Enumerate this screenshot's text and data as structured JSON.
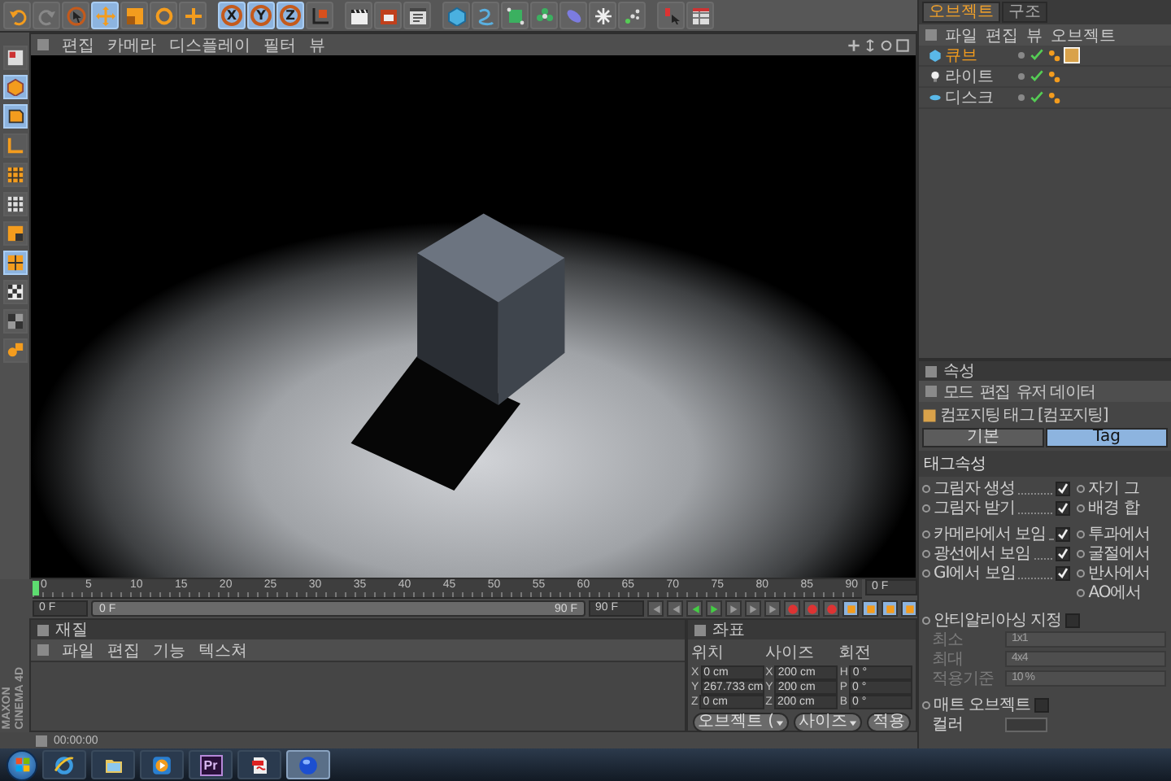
{
  "toolbar": [
    {
      "selected": false
    },
    {
      "selected": false
    },
    {
      "selected": false
    },
    {
      "selected": true
    },
    {
      "selected": false
    },
    {
      "selected": false
    },
    {
      "selected": false
    },
    {
      "label": "X",
      "selected": true
    },
    {
      "label": "Y",
      "selected": true
    },
    {
      "label": "Z",
      "selected": true
    },
    {
      "selected": false
    },
    {
      "selected": false
    },
    {
      "selected": false
    },
    {
      "selected": false
    },
    {
      "selected": false
    },
    {
      "selected": false
    },
    {
      "selected": false
    },
    {
      "selected": false
    },
    {
      "selected": false
    },
    {
      "selected": false
    },
    {
      "selected": false
    },
    {
      "selected": false
    },
    {
      "selected": false
    }
  ],
  "left_toolbar": [
    {
      "selected": false
    },
    {
      "selected": true
    },
    {
      "selected": true
    },
    {
      "selected": false
    },
    {
      "selected": false
    },
    {
      "selected": false
    },
    {
      "selected": false
    },
    {
      "selected": true
    },
    {
      "selected": false
    },
    {
      "selected": false
    },
    {
      "selected": false
    }
  ],
  "viewport": {
    "menu": [
      "편집",
      "카메라",
      "디스플레이",
      "필터",
      "뷰"
    ]
  },
  "timeline": {
    "ruler": [
      "0",
      "5",
      "10",
      "15",
      "20",
      "25",
      "30",
      "35",
      "40",
      "45",
      "50",
      "55",
      "60",
      "65",
      "70",
      "75",
      "80",
      "85",
      "90"
    ],
    "playhead": {
      "level": 0
    },
    "current_frame": "0 F",
    "start": "0 F",
    "slider_start": "0 F",
    "slider_end": "90 F",
    "end": "90 F"
  },
  "logo": {
    "line_1": "MAXON",
    "line_2": "CINEMA 4D"
  },
  "material": {
    "title": "재질",
    "menu": [
      "파일",
      "편집",
      "기능",
      "텍스쳐"
    ]
  },
  "coordinates": {
    "title": "좌표",
    "headers": [
      "위치",
      "사이즈",
      "회전"
    ],
    "rows": [
      [
        {
          "axis": "X",
          "value": "0 cm"
        },
        {
          "axis": "X",
          "value": "200 cm"
        },
        {
          "axis": "H",
          "value": "0 °"
        }
      ],
      [
        {
          "axis": "Y",
          "value": "267.733 cm"
        },
        {
          "axis": "Y",
          "value": "200 cm"
        },
        {
          "axis": "P",
          "value": "0 °"
        }
      ],
      [
        {
          "axis": "Z",
          "value": "0 cm"
        },
        {
          "axis": "Z",
          "value": "200 cm"
        },
        {
          "axis": "B",
          "value": "0 °"
        }
      ]
    ],
    "mode": "오브젝트 (",
    "size_mode": "사이즈",
    "apply": "적용"
  },
  "status_bar": {
    "time": "00:00:00"
  },
  "object_manager": {
    "tabs": [
      {
        "label": "오브젝트",
        "selected": true
      },
      {
        "label": "구조",
        "selected": false
      }
    ],
    "menu": [
      "파일",
      "편집",
      "뷰",
      "오브젝트"
    ],
    "objects": [
      {
        "name": "큐브",
        "selected": true
      },
      {
        "name": "라이트",
        "selected": false
      },
      {
        "name": "디스크",
        "selected": false
      }
    ]
  },
  "attributes": {
    "title": "속성",
    "menu": [
      "모드",
      "편집",
      "유저 데이터"
    ],
    "tag_title": "컴포지팅 태그 [컴포지팅]",
    "tabs": [
      {
        "label": "기본",
        "selected": false
      },
      {
        "label": "Tag",
        "selected": true
      }
    ],
    "section": "태그속성",
    "options_left": [
      {
        "label": "그림자 생성",
        "checked": true
      },
      {
        "label": "그림자 받기",
        "checked": true
      },
      {
        "label": "카메라에서 보임",
        "checked": true
      },
      {
        "label": "광선에서 보임",
        "checked": true
      },
      {
        "label": "GI에서 보임",
        "checked": true
      }
    ],
    "options_right": [
      "자기 그",
      "배경 합",
      "투과에서",
      "굴절에서",
      "반사에서",
      "AO에서"
    ],
    "antialias": {
      "label": "안티알리아싱 지정",
      "checked": false
    },
    "fields": [
      {
        "label": "최소",
        "value": "1x1",
        "disabled": true
      },
      {
        "label": "최대",
        "value": "4x4",
        "disabled": true
      },
      {
        "label": "적용기준",
        "value": "10 %",
        "disabled": true
      }
    ],
    "matte": {
      "label": "매트 오브젝트",
      "checked": false
    },
    "color": {
      "label": "컬러"
    }
  },
  "taskbar": {
    "apps": [
      {
        "selected": false
      },
      {
        "selected": false
      },
      {
        "selected": false
      },
      {
        "label": "Pr",
        "selected": false
      },
      {
        "selected": false
      },
      {
        "selected": true
      }
    ]
  }
}
